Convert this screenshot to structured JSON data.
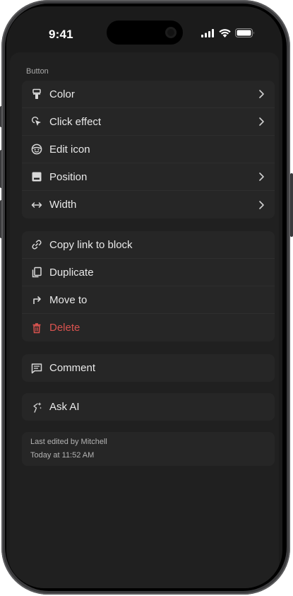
{
  "status_bar": {
    "time": "9:41"
  },
  "menu": {
    "section_title": "Button",
    "groups": [
      [
        {
          "label": "Color",
          "icon": "paint-roller-icon",
          "has_submenu": true
        },
        {
          "label": "Click effect",
          "icon": "cursor-click-icon",
          "has_submenu": true
        },
        {
          "label": "Edit icon",
          "icon": "emoji-face-icon",
          "has_submenu": false
        },
        {
          "label": "Position",
          "icon": "position-icon",
          "has_submenu": true
        },
        {
          "label": "Width",
          "icon": "width-arrows-icon",
          "has_submenu": true
        }
      ],
      [
        {
          "label": "Copy link to block",
          "icon": "link-icon"
        },
        {
          "label": "Duplicate",
          "icon": "duplicate-icon"
        },
        {
          "label": "Move to",
          "icon": "move-to-icon"
        },
        {
          "label": "Delete",
          "icon": "trash-icon",
          "danger": true
        }
      ],
      [
        {
          "label": "Comment",
          "icon": "comment-icon"
        }
      ],
      [
        {
          "label": "Ask AI",
          "icon": "ai-sparkle-icon"
        }
      ]
    ],
    "footer": {
      "edited_by": "Last edited by Mitchell",
      "edited_at": "Today at 11:52 AM"
    }
  },
  "colors": {
    "background": "#1b1b1b",
    "sheet": "#202020",
    "group": "#262626",
    "text": "#e9e9e9",
    "danger": "#d9534f"
  }
}
